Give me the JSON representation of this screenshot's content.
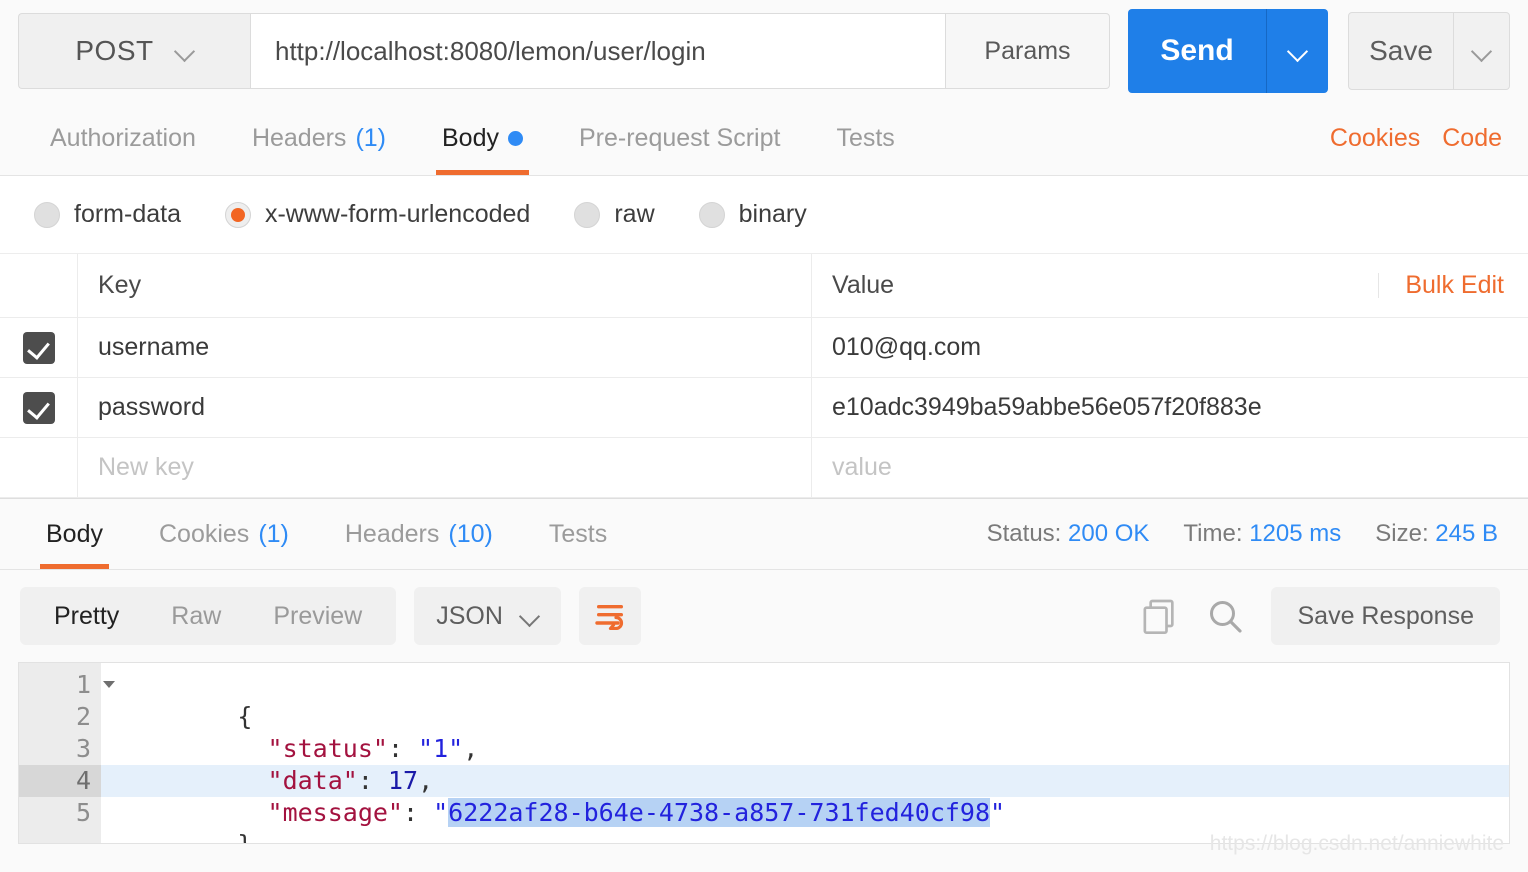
{
  "request": {
    "method": "POST",
    "url": "http://localhost:8080/lemon/user/login",
    "params_label": "Params",
    "send_label": "Send",
    "save_label": "Save",
    "tabs": [
      {
        "label": "Authorization",
        "count": "",
        "active": false,
        "dot": false
      },
      {
        "label": "Headers",
        "count": "(1)",
        "active": false,
        "dot": false
      },
      {
        "label": "Body",
        "count": "",
        "active": true,
        "dot": true
      },
      {
        "label": "Pre-request Script",
        "count": "",
        "active": false,
        "dot": false
      },
      {
        "label": "Tests",
        "count": "",
        "active": false,
        "dot": false
      }
    ],
    "cookies_link": "Cookies",
    "code_link": "Code",
    "body_types": [
      {
        "label": "form-data",
        "selected": false
      },
      {
        "label": "x-www-form-urlencoded",
        "selected": true
      },
      {
        "label": "raw",
        "selected": false
      },
      {
        "label": "binary",
        "selected": false
      }
    ],
    "table": {
      "col_key": "Key",
      "col_value": "Value",
      "bulk_edit": "Bulk Edit",
      "rows": [
        {
          "checked": true,
          "key": "username",
          "value": "010@qq.com"
        },
        {
          "checked": true,
          "key": "password",
          "value": "e10adc3949ba59abbe56e057f20f883e"
        }
      ],
      "new_row": {
        "key_placeholder": "New key",
        "value_placeholder": "value"
      }
    }
  },
  "response": {
    "tabs": [
      {
        "label": "Body",
        "count": "",
        "active": true
      },
      {
        "label": "Cookies",
        "count": "(1)",
        "active": false
      },
      {
        "label": "Headers",
        "count": "(10)",
        "active": false
      },
      {
        "label": "Tests",
        "count": "",
        "active": false
      }
    ],
    "status_label": "Status:",
    "status_value": "200 OK",
    "time_label": "Time:",
    "time_value": "1205 ms",
    "size_label": "Size:",
    "size_value": "245 B",
    "view_modes": [
      {
        "label": "Pretty",
        "active": true
      },
      {
        "label": "Raw",
        "active": false
      },
      {
        "label": "Preview",
        "active": false
      }
    ],
    "format": "JSON",
    "save_response_label": "Save Response",
    "body_lines": [
      {
        "num": "1",
        "folded": true,
        "current": false,
        "tokens": [
          {
            "t": "{",
            "c": "k-punc"
          }
        ]
      },
      {
        "num": "2",
        "folded": false,
        "current": false,
        "tokens": [
          {
            "t": "  \"status\"",
            "c": "k-key"
          },
          {
            "t": ": ",
            "c": "k-punc"
          },
          {
            "t": "\"1\"",
            "c": "k-str"
          },
          {
            "t": ",",
            "c": "k-punc"
          }
        ]
      },
      {
        "num": "3",
        "folded": false,
        "current": false,
        "tokens": [
          {
            "t": "  \"data\"",
            "c": "k-key"
          },
          {
            "t": ": ",
            "c": "k-punc"
          },
          {
            "t": "17",
            "c": "k-num"
          },
          {
            "t": ",",
            "c": "k-punc"
          }
        ]
      },
      {
        "num": "4",
        "folded": false,
        "current": true,
        "tokens": [
          {
            "t": "  \"message\"",
            "c": "k-key"
          },
          {
            "t": ": ",
            "c": "k-punc"
          },
          {
            "t": "\"",
            "c": "k-str"
          },
          {
            "t": "6222af28-b64e-4738-a857-731fed40cf98",
            "c": "sel"
          },
          {
            "t": "\"",
            "c": "k-str"
          }
        ]
      },
      {
        "num": "5",
        "folded": false,
        "current": false,
        "tokens": [
          {
            "t": "}",
            "c": "k-punc"
          }
        ]
      }
    ]
  },
  "watermark": "https://blog.csdn.net/anniewhite",
  "colors": {
    "accent_orange": "#ef6c2f",
    "accent_blue": "#2f8bf5",
    "send_blue": "#1f7fe8",
    "checkbox_dark": "#4d4d4d",
    "selection": "#b6d2f4"
  }
}
